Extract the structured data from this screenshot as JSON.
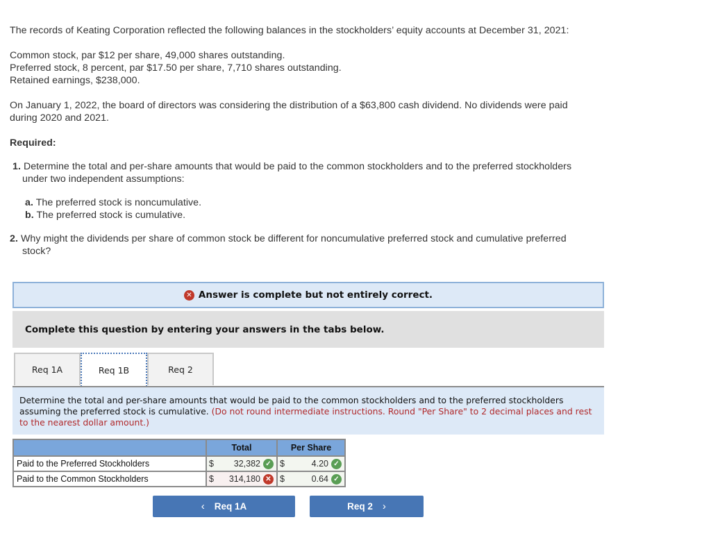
{
  "question": {
    "intro": "The records of Keating Corporation reflected the following balances in the stockholders’ equity accounts at December 31, 2021:",
    "balances": [
      "Common stock, par $12 per share, 49,000 shares outstanding.",
      "Preferred stock, 8 percent, par $17.50 per share, 7,710 shares outstanding.",
      "Retained earnings, $238,000."
    ],
    "context_line1": "On January 1, 2022, the board of directors was considering the distribution of a $63,800 cash dividend. No dividends were paid",
    "context_line2": "during 2020 and 2021.",
    "required_label": "Required:",
    "req1_num": "1.",
    "req1_line1": "Determine the total and per-share amounts that would be paid to the common stockholders and to the preferred stockholders",
    "req1_line2": "under two independent assumptions:",
    "sub_a_label": "a.",
    "sub_a_text": "The preferred stock is noncumulative.",
    "sub_b_label": "b.",
    "sub_b_text": "The preferred stock is cumulative.",
    "req2_num": "2.",
    "req2_line1": "Why might the dividends per share of common stock be different for noncumulative preferred stock and cumulative preferred",
    "req2_line2": "stock?"
  },
  "banner": {
    "status_icon": "x-circle-icon",
    "text": "Answer is complete but not entirely correct."
  },
  "instruction": "Complete this question by entering your answers in the tabs below.",
  "tabs": [
    {
      "label": "Req 1A",
      "active": false
    },
    {
      "label": "Req 1B",
      "active": true
    },
    {
      "label": "Req 2",
      "active": false
    }
  ],
  "panel": {
    "text": "Determine the total and per-share amounts that would be paid to the common stockholders and to the preferred stockholders assuming the preferred stock is cumulative.",
    "note": "(Do not round intermediate instructions. Round \"Per Share\" to 2 decimal places and rest to the nearest dollar amount.)"
  },
  "table": {
    "headers": [
      "",
      "Total",
      "Per Share"
    ],
    "rows": [
      {
        "label": "Paid to the Preferred Stockholders",
        "total_currency": "$",
        "total": "32,382",
        "total_status": "correct",
        "per_share_currency": "$",
        "per_share": "4.20",
        "per_share_status": "correct"
      },
      {
        "label": "Paid to the Common Stockholders",
        "total_currency": "$",
        "total": "314,180",
        "total_status": "incorrect",
        "per_share_currency": "$",
        "per_share": "0.64",
        "per_share_status": "correct"
      }
    ]
  },
  "nav": {
    "prev_label": "Req 1A",
    "prev_icon": "‹",
    "next_label": "Req 2",
    "next_icon": "›"
  },
  "colors": {
    "correct": "#5a9e55",
    "incorrect": "#c0392b",
    "accent": "#4776b5"
  }
}
